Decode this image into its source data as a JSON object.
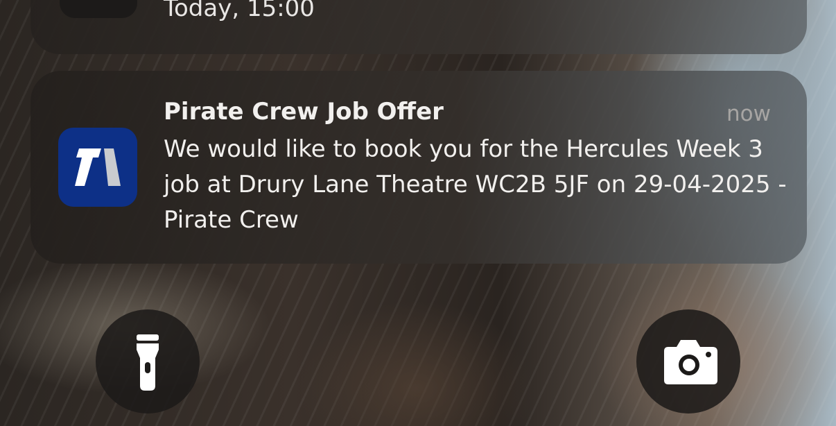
{
  "previous_notification": {
    "time": "Today, 15:00"
  },
  "notification": {
    "app_icon": "pirate-crew-app-icon",
    "title": "Pirate Crew Job Offer",
    "time": "now",
    "body": "We would like to book you for the Hercules Week 3 job at Drury Lane Theatre WC2B 5JF on 29-04-2025 - Pirate Crew"
  },
  "quick_actions": [
    {
      "icon": "flashlight-icon"
    },
    {
      "icon": "camera-icon"
    }
  ],
  "colors": {
    "app_icon_background": "#0d3087",
    "app_icon_glyph_light": "#ffffff",
    "app_icon_glyph_shade": "#c9cbcf"
  }
}
